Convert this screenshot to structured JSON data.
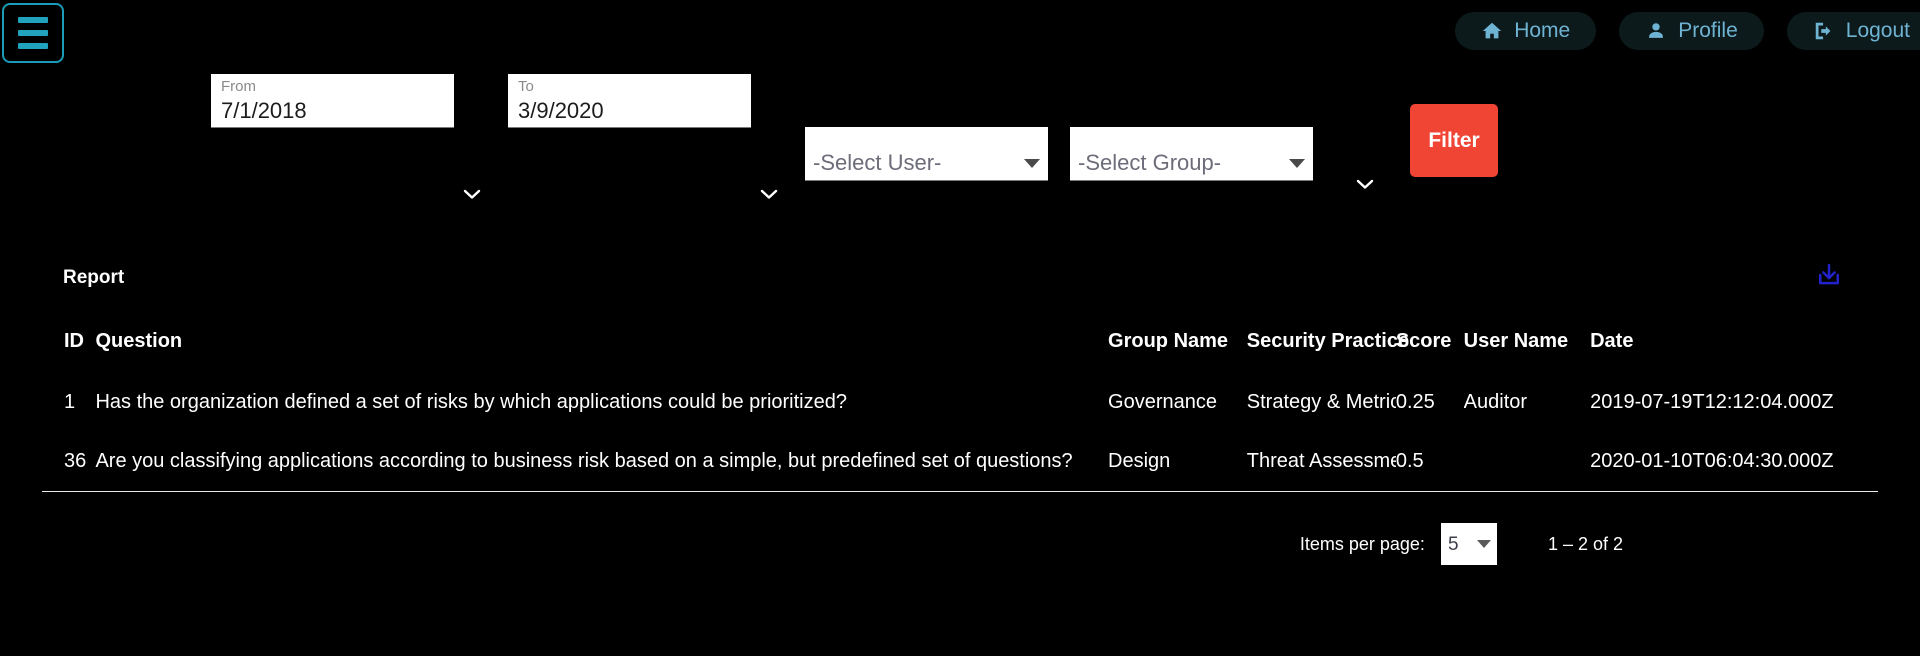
{
  "header": {
    "menu_icon": "hamburger-menu-icon",
    "nav": [
      {
        "label": "Home",
        "icon": "home-icon"
      },
      {
        "label": "Profile",
        "icon": "person-icon"
      },
      {
        "label": "Logout",
        "icon": "logout-icon"
      }
    ]
  },
  "filters": {
    "from": {
      "label": "From",
      "value": "7/1/2018",
      "toggle_icon": "chevron-down-icon"
    },
    "to": {
      "label": "To",
      "value": "3/9/2020",
      "toggle_icon": "chevron-down-icon"
    },
    "user_select": {
      "value": "-Select User-",
      "arrow_icon": "dropdown-arrow-icon"
    },
    "group_select": {
      "value": "-Select Group-",
      "arrow_icon": "dropdown-arrow-icon"
    },
    "extra_toggle_icon": "chevron-down-icon",
    "filter_button": "Filter"
  },
  "report": {
    "title": "Report",
    "download_icon": "download-icon",
    "columns": [
      "ID",
      "Question",
      "Group Name",
      "Security Practice",
      "Score",
      "User Name",
      "Date"
    ],
    "rows": [
      {
        "id": "1",
        "question": "Has the organization defined a set of risks by which applications could be prioritized?",
        "group_name": "Governance",
        "security_practice": "Strategy & Metrics",
        "score": "0.25",
        "user_name": "Auditor",
        "date": "2019-07-19T12:12:04.000Z"
      },
      {
        "id": "36",
        "question": "Are you classifying applications according to business risk based on a simple, but predefined set of questions?",
        "group_name": "Design",
        "security_practice": "Threat Assessment",
        "score": "0.5",
        "user_name": "",
        "date": "2020-01-10T06:04:30.000Z"
      }
    ]
  },
  "paginator": {
    "items_per_page_label": "Items per page:",
    "items_per_page_value": "5",
    "arrow_icon": "dropdown-arrow-icon",
    "range_label": "1 – 2 of 2"
  },
  "colors": {
    "background": "#000000",
    "accent_teal": "#22a3bd",
    "nav_text": "#6fb3d2",
    "nav_pill": "#0c1a1c",
    "filter_button": "#f04434",
    "download_icon": "#2222cc",
    "field_white": "#ffffff"
  }
}
